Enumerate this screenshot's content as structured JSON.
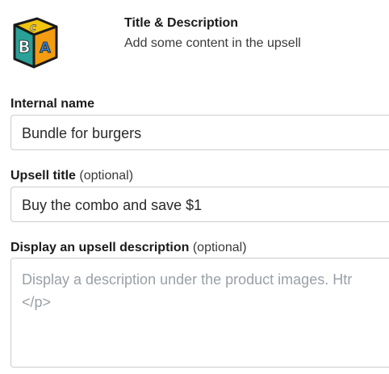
{
  "header": {
    "title": "Title & Description",
    "subtitle": "Add some content in the upsell",
    "logo_icon": "abc-blocks-icon"
  },
  "fields": {
    "internal_name": {
      "label": "Internal name",
      "value": "Bundle for burgers"
    },
    "upsell_title": {
      "label": "Upsell title",
      "optional": "(optional)",
      "value": "Buy the combo and save $1"
    },
    "upsell_description": {
      "label": "Display an upsell description",
      "optional": "(optional)",
      "placeholder_line1": "Display a description under the product images. Htr",
      "placeholder_line2": "</p>"
    }
  },
  "colors": {
    "block_orange": "#f39c12",
    "block_teal": "#2aa198",
    "block_yellow": "#f1c40f",
    "block_blue": "#2f7fd6",
    "outline": "#1a1a1a"
  }
}
